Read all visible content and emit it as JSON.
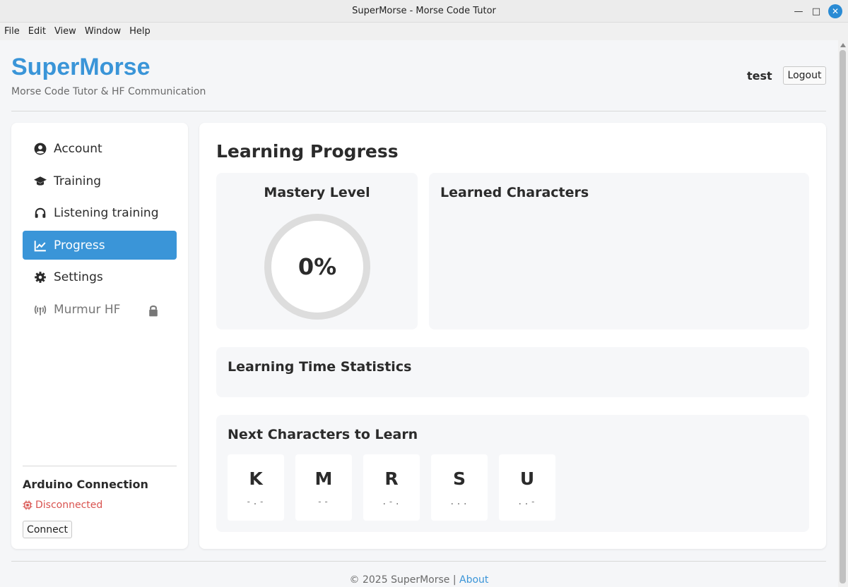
{
  "window": {
    "title": "SuperMorse - Morse Code Tutor"
  },
  "menu": [
    "File",
    "Edit",
    "View",
    "Window",
    "Help"
  ],
  "header": {
    "brand": "SuperMorse",
    "tagline": "Morse Code Tutor & HF Communication",
    "username": "test",
    "logout_label": "Logout"
  },
  "sidebar": {
    "items": [
      {
        "label": "Account",
        "icon": "user-circle-icon"
      },
      {
        "label": "Training",
        "icon": "graduation-cap-icon"
      },
      {
        "label": "Listening training",
        "icon": "headphones-icon"
      },
      {
        "label": "Progress",
        "icon": "line-chart-icon",
        "active": true
      },
      {
        "label": "Settings",
        "icon": "gear-icon"
      },
      {
        "label": "Murmur HF",
        "icon": "antenna-icon",
        "locked": true
      }
    ],
    "arduino": {
      "title": "Arduino Connection",
      "status": "Disconnected",
      "connect_label": "Connect"
    }
  },
  "main": {
    "title": "Learning Progress",
    "mastery": {
      "title": "Mastery Level",
      "value": "0%",
      "fraction": 0
    },
    "learned": {
      "title": "Learned Characters"
    },
    "time_stats": {
      "title": "Learning Time Statistics"
    },
    "next_chars": {
      "title": "Next Characters to Learn",
      "chars": [
        {
          "letter": "K",
          "code": "-.-"
        },
        {
          "letter": "M",
          "code": "--"
        },
        {
          "letter": "R",
          "code": ".-."
        },
        {
          "letter": "S",
          "code": "..."
        },
        {
          "letter": "U",
          "code": "..-"
        }
      ]
    }
  },
  "footer": {
    "copyright": "© 2025 SuperMorse",
    "separator": "|",
    "about": "About"
  },
  "colors": {
    "accent": "#3a95d8",
    "error": "#d9534f"
  }
}
